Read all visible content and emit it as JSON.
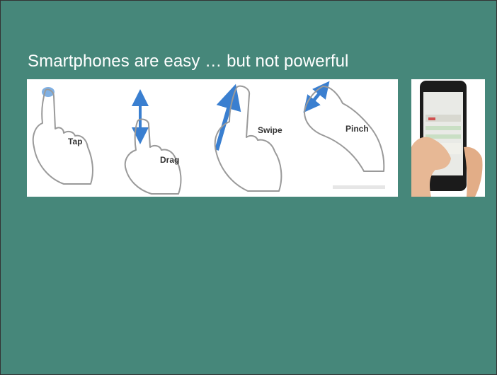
{
  "slide": {
    "title": "Smartphones are easy … but not powerful"
  },
  "gestures": {
    "items": [
      {
        "label": "Tap",
        "icon": "tap-gesture-icon"
      },
      {
        "label": "Drag",
        "icon": "drag-gesture-icon"
      },
      {
        "label": "Swipe",
        "icon": "swipe-gesture-icon"
      },
      {
        "label": "Pinch",
        "icon": "pinch-gesture-icon"
      }
    ]
  },
  "colors": {
    "background": "#46877a",
    "accent_blue": "#3a7fd0",
    "hand_outline": "#9a9a9a"
  }
}
